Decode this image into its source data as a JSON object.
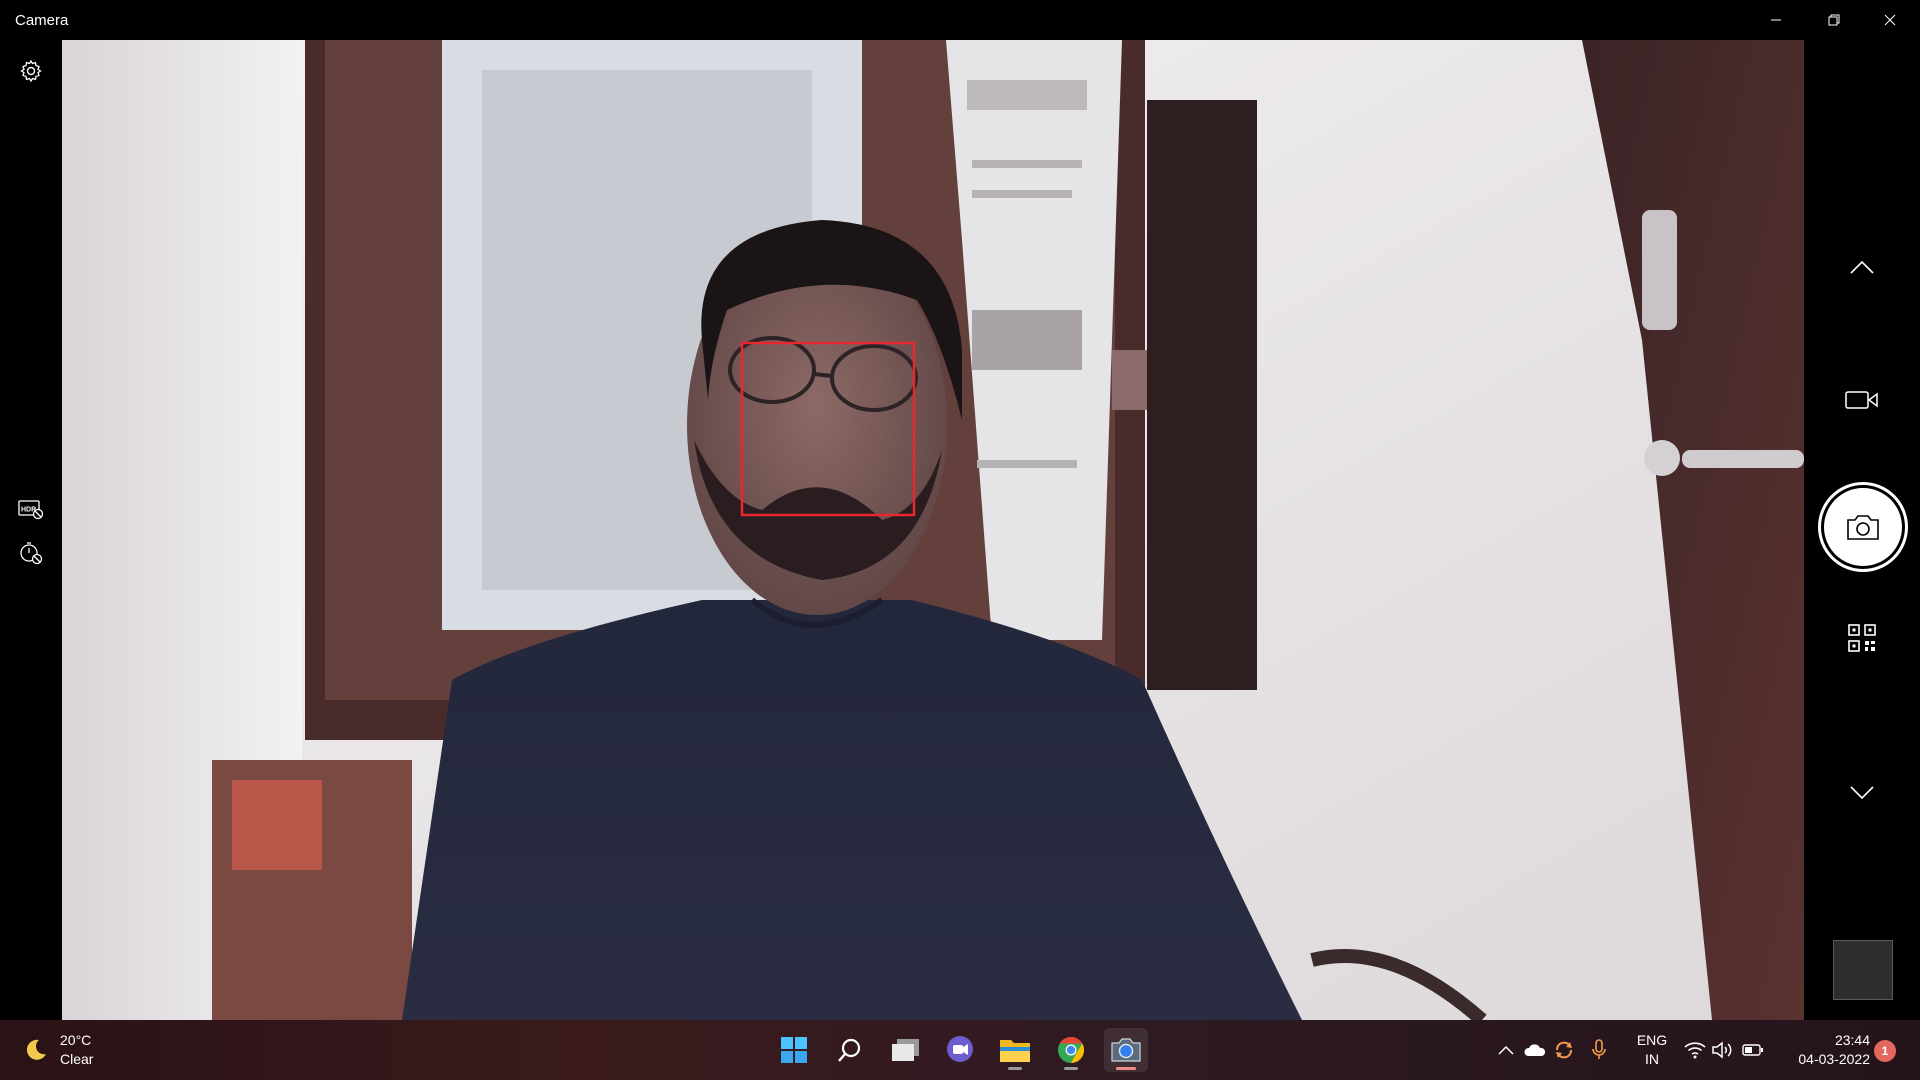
{
  "window": {
    "title": "Camera"
  },
  "left_rail": {
    "icons": [
      "gear-icon",
      "hdr-off-icon",
      "timer-off-icon"
    ]
  },
  "right_rail": {
    "icons": [
      "chevron-up-icon",
      "video-camera-icon",
      "camera-icon",
      "qr-code-icon",
      "chevron-down-icon"
    ]
  },
  "taskbar": {
    "weather": {
      "temp": "20°C",
      "condition": "Clear",
      "icon": "moon-icon"
    },
    "apps": [
      "windows-start-icon",
      "search-icon",
      "task-view-icon",
      "teams-chat-icon",
      "file-explorer-icon",
      "chrome-icon",
      "camera-app-icon"
    ],
    "tray": [
      "chevron-up-icon",
      "onedrive-icon",
      "sync-icon",
      "microphone-icon"
    ],
    "language": {
      "line1": "ENG",
      "line2": "IN"
    },
    "system": [
      "wifi-icon",
      "volume-icon",
      "battery-icon"
    ],
    "clock": {
      "time": "23:44",
      "date": "04-03-2022"
    },
    "notifications": "1"
  },
  "colors": {
    "face_box": "#e8272f",
    "accent_indicator": "#f08a8a",
    "notification": "#e3675f"
  }
}
